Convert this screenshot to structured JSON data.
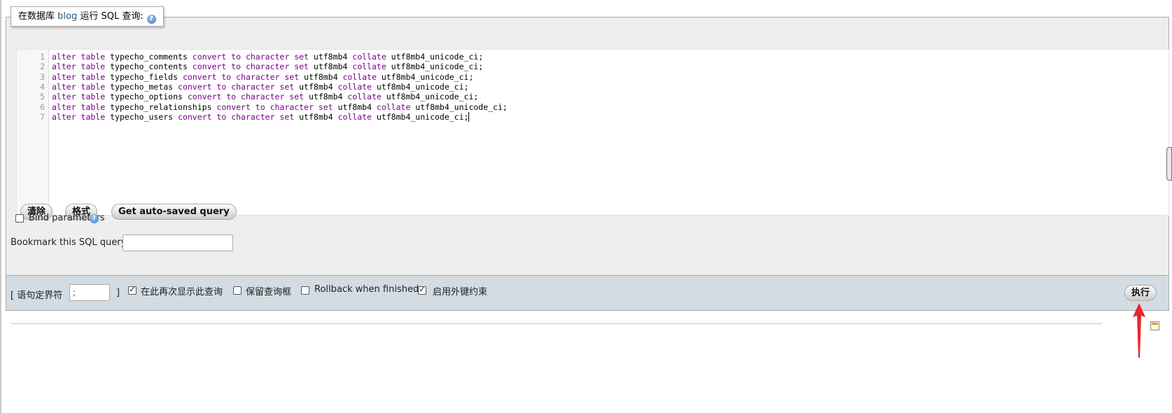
{
  "query_box": {
    "legend": {
      "prefix": "在数据库",
      "db_name": "blog",
      "suffix": "运行 SQL 查询:"
    },
    "help_icon": "help-icon"
  },
  "editor": {
    "line_numbers": [
      "1",
      "2",
      "3",
      "4",
      "5",
      "6",
      "7"
    ],
    "lines": [
      {
        "kw1": "alter table",
        "table": " typecho_comments ",
        "kw2": "convert to character set",
        "cs": " utf8mb4 ",
        "kw3": "collate",
        "coll": " utf8mb4_unicode_ci;"
      },
      {
        "kw1": "alter table",
        "table": " typecho_contents ",
        "kw2": "convert to character set",
        "cs": " utf8mb4 ",
        "kw3": "collate",
        "coll": " utf8mb4_unicode_ci;"
      },
      {
        "kw1": "alter table",
        "table": " typecho_fields ",
        "kw2": "convert to character set",
        "cs": " utf8mb4 ",
        "kw3": "collate",
        "coll": " utf8mb4_unicode_ci;"
      },
      {
        "kw1": "alter table",
        "table": " typecho_metas ",
        "kw2": "convert to character set",
        "cs": " utf8mb4 ",
        "kw3": "collate",
        "coll": " utf8mb4_unicode_ci;"
      },
      {
        "kw1": "alter table",
        "table": " typecho_options ",
        "kw2": "convert to character set",
        "cs": " utf8mb4 ",
        "kw3": "collate",
        "coll": " utf8mb4_unicode_ci;"
      },
      {
        "kw1": "alter table",
        "table": " typecho_relationships ",
        "kw2": "convert to character set",
        "cs": " utf8mb4 ",
        "kw3": "collate",
        "coll": " utf8mb4_unicode_ci;"
      },
      {
        "kw1": "alter table",
        "table": " typecho_users ",
        "kw2": "convert to character set",
        "cs": " utf8mb4 ",
        "kw3": "collate",
        "coll": " utf8mb4_unicode_ci;"
      }
    ],
    "keyword_color": "#770088"
  },
  "buttons": {
    "clear": "清除",
    "format": "格式",
    "autosaved": "Get auto-saved query",
    "execute": "执行"
  },
  "bind_parameters": {
    "label": "Bind parameters",
    "checked": false
  },
  "bookmark": {
    "label": "Bookmark this SQL query:",
    "value": ""
  },
  "footer": {
    "delimiter_open": "[ 语句定界符",
    "delimiter_value": ";",
    "delimiter_close": "]",
    "show_query_label": "在此再次显示此查询",
    "show_query_checked": true,
    "retain_box_label": "保留查询框",
    "retain_box_checked": false,
    "rollback_label": "Rollback when finished",
    "rollback_checked": false,
    "fk_label": "启用外键约束",
    "fk_checked": true,
    "bar_color": "#d3dce3"
  },
  "annotation": {
    "arrow_color": "#e8262a"
  }
}
